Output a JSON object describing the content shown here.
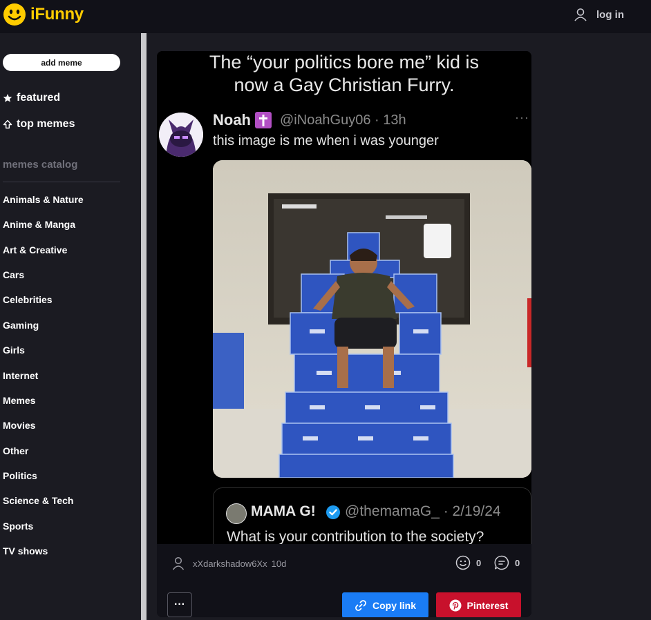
{
  "header": {
    "logo_text": "iFunny",
    "login_label": "log in"
  },
  "sidebar": {
    "add_meme_label": "add meme",
    "nav": [
      {
        "label": "featured",
        "icon": "star-icon"
      },
      {
        "label": "top memes",
        "icon": "arrow-up-icon"
      }
    ],
    "catalog_title": "memes catalog",
    "categories": [
      "Animals & Nature",
      "Anime & Manga",
      "Art & Creative",
      "Cars",
      "Celebrities",
      "Gaming",
      "Girls",
      "Internet",
      "Memes",
      "Movies",
      "Other",
      "Politics",
      "Science & Tech",
      "Sports",
      "TV shows"
    ]
  },
  "post": {
    "caption_line1": "The “your politics bore me” kid is",
    "caption_line2": "now a Gay Christian Furry.",
    "tweet": {
      "name": "Noah",
      "handle": "@iNoahGuy06 · 13h",
      "more": "···",
      "text": "this image is me when i was younger"
    },
    "quote": {
      "name": "MAMA G!",
      "handle": "@themamaG_ · 2/19/24",
      "text": "What is your contribution to the society?"
    },
    "author": "xXdarkshadow6Xx",
    "age": "10d",
    "smiles": "0",
    "comments": "0",
    "more_label": "···",
    "copy_link_label": "Copy link",
    "pinterest_label": "Pinterest"
  },
  "colors": {
    "brand": "#ffcc00",
    "background": "#1b1b22",
    "copy_link": "#1a7cf5",
    "pinterest": "#c8112c"
  }
}
